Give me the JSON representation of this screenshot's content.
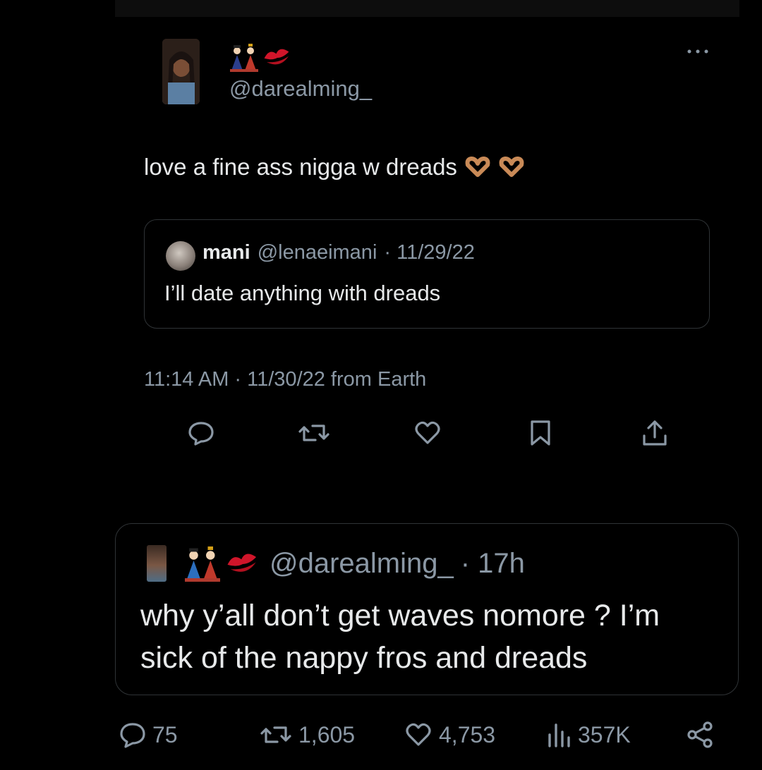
{
  "author": {
    "display_emoji": [
      "hina-dolls-emoji",
      "kiss-mark-emoji"
    ],
    "handle": "@darealming_"
  },
  "tweet": {
    "text": "love a fine ass nigga w dreads",
    "trailing_emoji": [
      "heart-hands-emoji",
      "heart-hands-emoji"
    ],
    "timestamp": "11:14 AM · 11/30/22 from Earth"
  },
  "quote": {
    "name": "mani",
    "handle": "@lenaeimani",
    "date": "· 11/29/22",
    "text": "I’ll date anything with dreads"
  },
  "actions": [
    "reply-icon",
    "retweet-icon",
    "like-icon",
    "bookmark-icon",
    "share-icon"
  ],
  "reply_card": {
    "handle": "@darealming_",
    "time": "· 17h",
    "text": "why y’all don’t get waves nomore ? I’m sick of the nappy fros and dreads"
  },
  "stats": {
    "replies": "75",
    "retweets": "1,605",
    "likes": "4,753",
    "views": "357K"
  },
  "colors": {
    "background": "#000000",
    "text": "#e7e9ea",
    "muted": "#8b98a5",
    "border": "#2f3336"
  }
}
